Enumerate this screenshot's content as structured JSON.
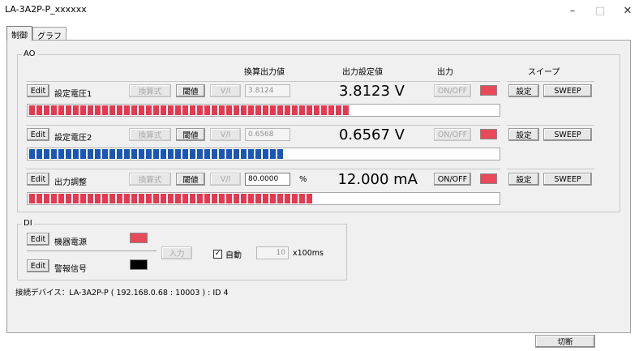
{
  "window": {
    "title": "LA-3A2P-P_xxxxxx",
    "minimize": "–",
    "maximize": "□",
    "close": "✕"
  },
  "tabs": [
    {
      "label": "制御"
    },
    {
      "label": "グラフ"
    }
  ],
  "ao": {
    "group_label": "AO",
    "headers": {
      "converted": "換算出力値",
      "setpoint": "出力設定値",
      "output": "出力",
      "sweep": "スイープ"
    },
    "rows": [
      {
        "edit": "Edit",
        "name": "設定電圧1",
        "formula": "換算式",
        "threshold": "閾値",
        "vi": "V/I",
        "field": "3.8124",
        "unit": "",
        "value": "3.8123 V",
        "onoff": "ON/OFF",
        "onoff_enabled": false,
        "set": "設定",
        "sweep": "SWEEP",
        "bar_color": "#e8384f",
        "bar_fill": 0.69,
        "swatch": "#e84a5a"
      },
      {
        "edit": "Edit",
        "name": "設定電圧2",
        "formula": "換算式",
        "threshold": "閾値",
        "vi": "V/I",
        "field": "0.6568",
        "unit": "",
        "value": "0.6567 V",
        "onoff": "ON/OFF",
        "onoff_enabled": false,
        "set": "設定",
        "sweep": "SWEEP",
        "bar_color": "#1a56b8",
        "bar_fill": 0.54,
        "swatch": "#e84a5a"
      },
      {
        "edit": "Edit",
        "name": "出力調整",
        "formula": "換算式",
        "threshold": "閾値",
        "vi": "V/I",
        "field": "80.0000",
        "unit": "%",
        "value": "12.000 mA",
        "onoff": "ON/OFF",
        "onoff_enabled": true,
        "set": "設定",
        "sweep": "SWEEP",
        "bar_color": "#e8384f",
        "bar_fill": 0.61,
        "swatch": "#e84a5a"
      }
    ]
  },
  "di": {
    "group_label": "DI",
    "items": [
      {
        "edit": "Edit",
        "name": "機器電源",
        "color": "#e84a5a"
      },
      {
        "edit": "Edit",
        "name": "警報信号",
        "color": "#000000"
      }
    ],
    "input_button": "入力",
    "auto_label": "自動",
    "auto_checked": "✓",
    "interval_value": "10",
    "interval_unit": "x100ms"
  },
  "status": "接続デバイス：LA-3A2P-P ( 192.168.0.68 : 10003 ) : ID 4",
  "disconnect": "切断"
}
